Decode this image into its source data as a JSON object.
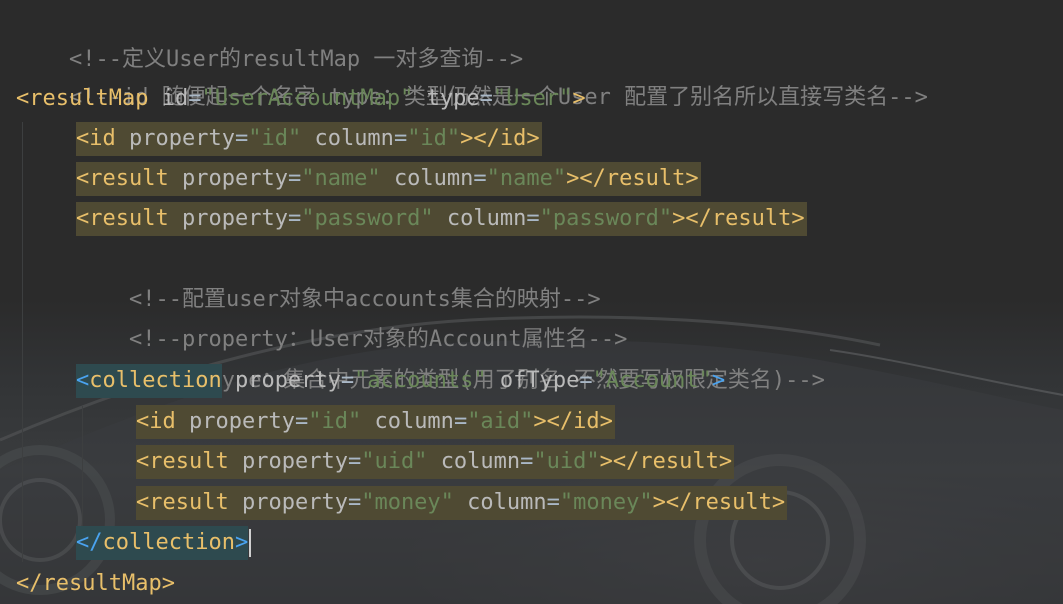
{
  "editor": {
    "lines": {
      "l1": "<!--定义User的resultMap 一对多查询-->",
      "l2": "<!--id 随便起一个名字 type：类型仍然是一个User 配置了别名所以直接写类名-->",
      "l3_tag": "resultMap",
      "l3_attr1": "id",
      "l3_val1": "\"UserAccountMap\"",
      "l3_attr2": "type",
      "l3_val2": "\"User\"",
      "l4_tag": "id",
      "l4_attr1": "property",
      "l4_val1": "\"id\"",
      "l4_attr2": "column",
      "l4_val2": "\"id\"",
      "l5_tag": "result",
      "l5_attr1": "property",
      "l5_val1": "\"name\"",
      "l5_attr2": "column",
      "l5_val2": "\"name\"",
      "l6_tag": "result",
      "l6_attr1": "property",
      "l6_val1": "\"password\"",
      "l6_attr2": "column",
      "l6_val2": "\"password\"",
      "l7": "<!--配置user对象中accounts集合的映射-->",
      "l8": "<!--property：User对象的Account属性名-->",
      "l9": "<!--ofType：集合中元素的类型(用了别名 不然要写权限定类名)-->",
      "l10_tag": "collection",
      "l10_attr1": "property",
      "l10_val1": "\"accounts\"",
      "l10_attr2": "ofType",
      "l10_val2": "\"Account\"",
      "l11_tag": "id",
      "l11_attr1": "property",
      "l11_val1": "\"id\"",
      "l11_attr2": "column",
      "l11_val2": "\"aid\"",
      "l12_tag": "result",
      "l12_attr1": "property",
      "l12_val1": "\"uid\"",
      "l12_attr2": "column",
      "l12_val2": "\"uid\"",
      "l13_tag": "result",
      "l13_attr1": "property",
      "l13_val1": "\"money\"",
      "l13_attr2": "column",
      "l13_val2": "\"money\"",
      "l14_tag": "collection",
      "l15_tag": "resultMap"
    },
    "colors": {
      "background": "#2b2b2b",
      "tag": "#e8bf6a",
      "matched_bracket": "#4aa3f0",
      "attribute": "#bababa",
      "string": "#6a8759",
      "comment": "#808080",
      "usage_highlight": "#4f4a33",
      "tag_highlight": "#2e4a4f"
    },
    "background_image": "car-silhouette"
  }
}
